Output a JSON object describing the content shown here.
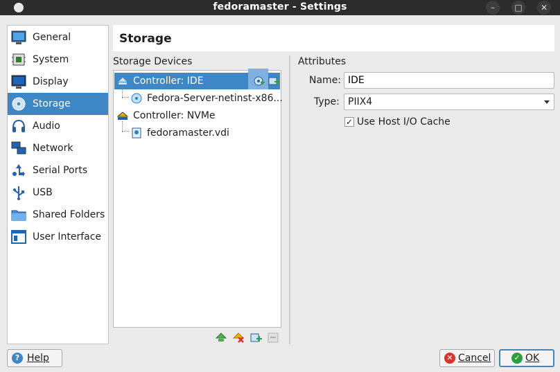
{
  "window": {
    "title": "fedoramaster - Settings",
    "minimize": "–",
    "maximize": "□",
    "close": "✕"
  },
  "sidebar": {
    "items": [
      {
        "label": "General"
      },
      {
        "label": "System"
      },
      {
        "label": "Display"
      },
      {
        "label": "Storage"
      },
      {
        "label": "Audio"
      },
      {
        "label": "Network"
      },
      {
        "label": "Serial Ports"
      },
      {
        "label": "USB"
      },
      {
        "label": "Shared Folders"
      },
      {
        "label": "User Interface"
      }
    ],
    "selected": "Storage"
  },
  "header": {
    "title": "Storage"
  },
  "storage": {
    "devices_label": "Storage Devices",
    "tree": [
      {
        "label": "Controller: IDE"
      },
      {
        "label": "Fedora-Server-netinst-x86..."
      },
      {
        "label": "Controller: NVMe"
      },
      {
        "label": "fedoramaster.vdi"
      }
    ]
  },
  "attributes": {
    "label": "Attributes",
    "name_label": "Name:",
    "name_value": "IDE",
    "type_label": "Type:",
    "type_value": "PIIX4",
    "cache_label": "Use Host I/O Cache",
    "cache_checked": "✓"
  },
  "buttons": {
    "help": "Help",
    "cancel": "Cancel",
    "ok": "OK"
  },
  "colors": {
    "accent": "#3d87c7",
    "titlebar": "#2c2c2c",
    "ok_icon": "#2e9e3e",
    "cancel_icon": "#d9342b",
    "help_icon": "#3d87c7"
  }
}
